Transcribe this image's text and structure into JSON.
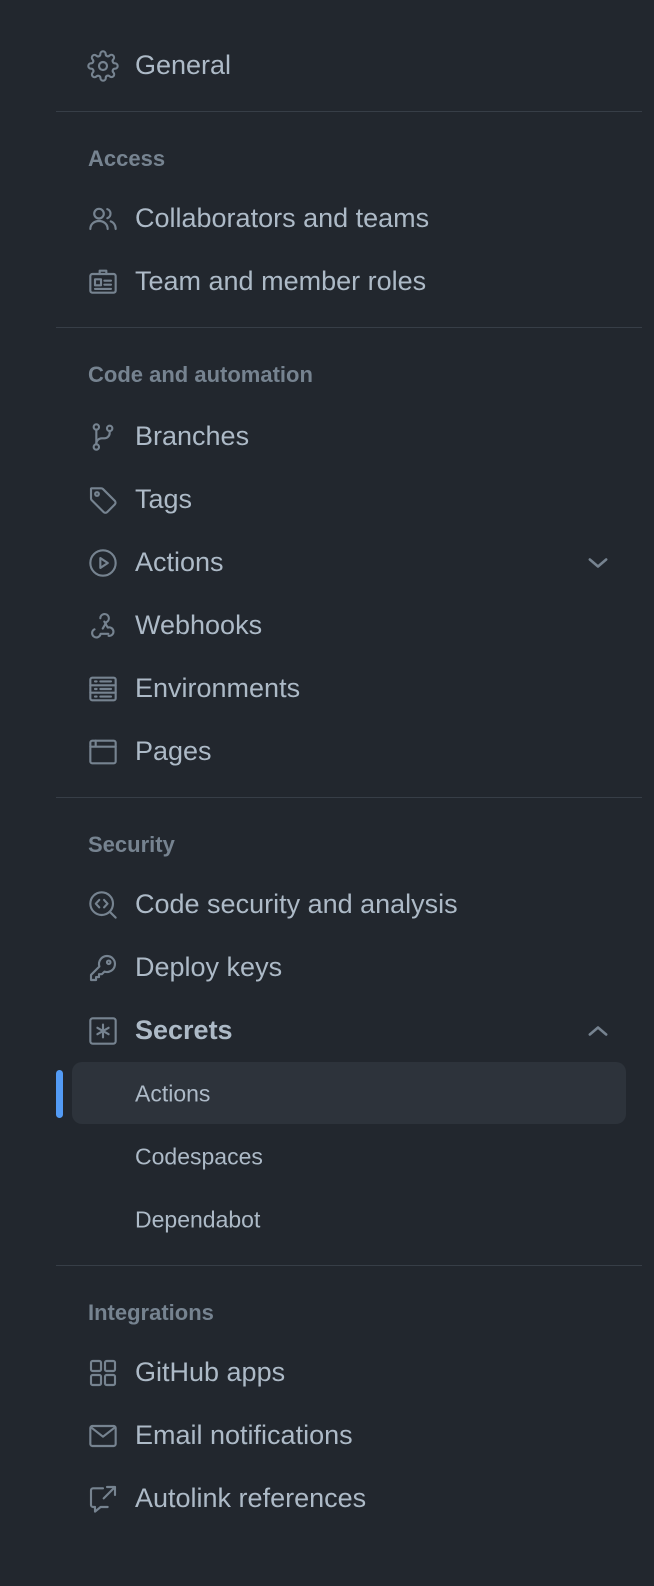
{
  "general": {
    "label": "General",
    "icon": "gear-icon"
  },
  "access": {
    "heading": "Access",
    "items": [
      {
        "label": "Collaborators and teams",
        "icon": "people-icon"
      },
      {
        "label": "Team and member roles",
        "icon": "id-badge-icon"
      }
    ]
  },
  "code_automation": {
    "heading": "Code and automation",
    "items": [
      {
        "label": "Branches",
        "icon": "git-branch-icon"
      },
      {
        "label": "Tags",
        "icon": "tag-icon"
      },
      {
        "label": "Actions",
        "icon": "play-icon",
        "expandable": true,
        "expanded": false
      },
      {
        "label": "Webhooks",
        "icon": "webhook-icon"
      },
      {
        "label": "Environments",
        "icon": "server-icon"
      },
      {
        "label": "Pages",
        "icon": "browser-icon"
      }
    ]
  },
  "security": {
    "heading": "Security",
    "items": [
      {
        "label": "Code security and analysis",
        "icon": "codescan-icon"
      },
      {
        "label": "Deploy keys",
        "icon": "key-icon"
      },
      {
        "label": "Secrets",
        "icon": "asterisk-box-icon",
        "expandable": true,
        "expanded": true
      }
    ],
    "secrets_subitems": [
      {
        "label": "Actions",
        "active": true
      },
      {
        "label": "Codespaces",
        "active": false
      },
      {
        "label": "Dependabot",
        "active": false
      }
    ]
  },
  "integrations": {
    "heading": "Integrations",
    "items": [
      {
        "label": "GitHub apps",
        "icon": "apps-icon"
      },
      {
        "label": "Email notifications",
        "icon": "mail-icon"
      },
      {
        "label": "Autolink references",
        "icon": "link-external-icon"
      }
    ]
  },
  "colors": {
    "background": "#22272e",
    "text": "#adbac7",
    "muted": "#768390",
    "active_bg": "#2d333b",
    "accent": "#539bf5",
    "divider": "#373e47"
  }
}
